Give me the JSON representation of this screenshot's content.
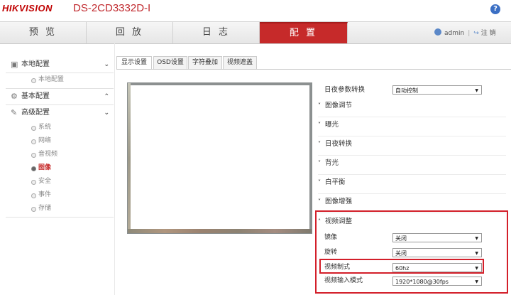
{
  "header": {
    "logo": "HIKVISION",
    "model": "DS-2CD3332D-I",
    "help_icon": "?"
  },
  "nav": {
    "tabs": [
      {
        "label": "预 览"
      },
      {
        "label": "回 放"
      },
      {
        "label": "日 志"
      },
      {
        "label": "配 置"
      }
    ],
    "active": "配 置",
    "user": "admin",
    "logout": "注 销"
  },
  "sidebar": {
    "sections": [
      {
        "label": "本地配置",
        "icon": "monitor-icon",
        "expanded": true,
        "items": [
          "本地配置"
        ]
      },
      {
        "label": "基本配置",
        "icon": "gear-icon",
        "expanded": false,
        "items": []
      },
      {
        "label": "高级配置",
        "icon": "wrench-icon",
        "expanded": true,
        "items": [
          "系统",
          "网络",
          "音视频",
          "图像",
          "安全",
          "事件",
          "存储"
        ]
      }
    ],
    "active_item": "图像"
  },
  "subtabs": [
    "显示设置",
    "OSD设置",
    "字符叠加",
    "视频遮盖"
  ],
  "settings": {
    "day_night_label": "日夜参数转换",
    "day_night_value": "自动控制",
    "sections": [
      "图像调节",
      "曝光",
      "日夜转换",
      "背光",
      "白平衡",
      "图像增强"
    ],
    "video_section": "视频调整",
    "mirror_label": "镜像",
    "mirror_value": "关闭",
    "rotate_label": "旋转",
    "rotate_value": "关闭",
    "video_std_label": "视频制式",
    "video_std_value": "60hz",
    "input_mode_label": "视频输入模式",
    "input_mode_value": "1920*1080@30fps"
  },
  "colors": {
    "accent": "#c62a2a",
    "highlight": "#d31f2a"
  }
}
